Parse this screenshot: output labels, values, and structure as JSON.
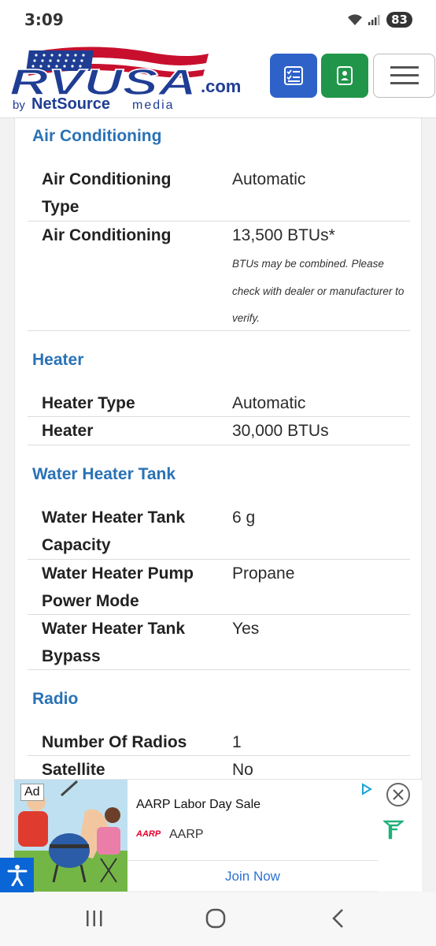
{
  "status": {
    "time": "3:09",
    "battery": "83"
  },
  "header": {
    "logo_main": "RVUSA",
    "logo_suffix": ".com",
    "logo_by": "by",
    "logo_netsource": "NetSource",
    "logo_media": "media"
  },
  "sections": {
    "ac": {
      "title": "Air Conditioning",
      "rows": [
        {
          "label": "Air Conditioning Type",
          "value": "Automatic"
        },
        {
          "label": "Air Conditioning",
          "value": "13,500 BTUs*",
          "note": "BTUs may be combined. Please check with dealer or manufacturer to verify."
        }
      ]
    },
    "heater": {
      "title": "Heater",
      "rows": [
        {
          "label": "Heater Type",
          "value": "Automatic"
        },
        {
          "label": "Heater",
          "value": "30,000 BTUs"
        }
      ]
    },
    "water": {
      "title": "Water Heater Tank",
      "rows": [
        {
          "label": "Water Heater Tank Capacity",
          "value": "6 g"
        },
        {
          "label": "Water Heater Pump Power Mode",
          "value": "Propane"
        },
        {
          "label": "Water Heater Tank Bypass",
          "value": "Yes"
        }
      ]
    },
    "radio": {
      "title": "Radio",
      "rows": [
        {
          "label": "Number Of Radios",
          "value": "1"
        },
        {
          "label": "Satellite",
          "value": "No"
        }
      ]
    }
  },
  "ad": {
    "label": "Ad",
    "title": "AARP Labor Day Sale",
    "brand_logo": "AARP",
    "brand": "AARP",
    "cta": "Join Now"
  },
  "colors": {
    "section_title": "#2a72b5",
    "list_button": "#2f62c9",
    "contact_button": "#21964a",
    "accessibility": "#0a66d6"
  },
  "icons": {
    "list_button": "checklist-icon",
    "contact_button": "contact-card-icon",
    "menu_button": "hamburger-menu-icon",
    "ad_close": "close-icon",
    "accessibility": "accessibility-icon",
    "nav": [
      "recent-apps-icon",
      "home-icon",
      "back-icon"
    ]
  }
}
